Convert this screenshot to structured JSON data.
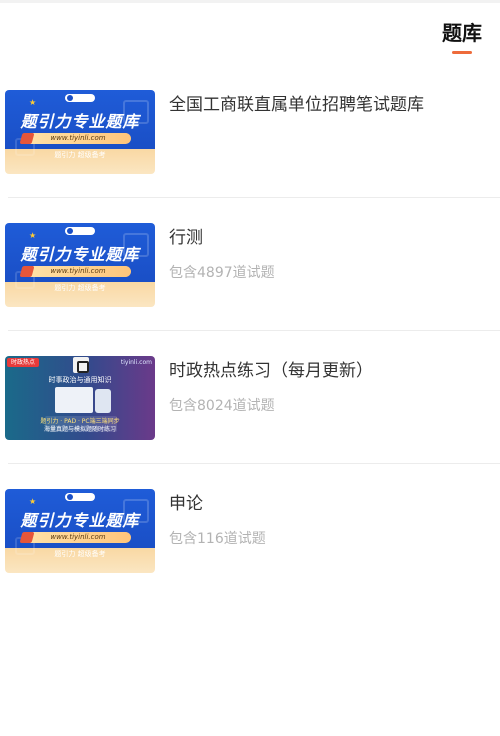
{
  "header": {
    "tab_label": "题库",
    "accent_color": "#ee6b3b"
  },
  "banner": {
    "title": "题引力专业题库",
    "url": "www.tiyinli.com",
    "slogan": "题引力 超级备考",
    "slogan_alt": "题引力 超级备考"
  },
  "news_banner": {
    "tag": "时政热点",
    "site": "tiyinli.com",
    "headline": "时事政治与通用知识",
    "caption_line1": "题引力 · PAD · PC端三端同步",
    "caption_line2": "海量真题与模拟题随时练习"
  },
  "items": [
    {
      "title": "全国工商联直属单位招聘笔试题库",
      "subtitle": "",
      "thumb": "blue-banner"
    },
    {
      "title": "行测",
      "subtitle": "包含4897道试题",
      "thumb": "blue-banner"
    },
    {
      "title": "时政热点练习（每月更新）",
      "subtitle": "包含8024道试题",
      "thumb": "news-banner"
    },
    {
      "title": "申论",
      "subtitle": "包含116道试题",
      "thumb": "blue-banner"
    }
  ]
}
